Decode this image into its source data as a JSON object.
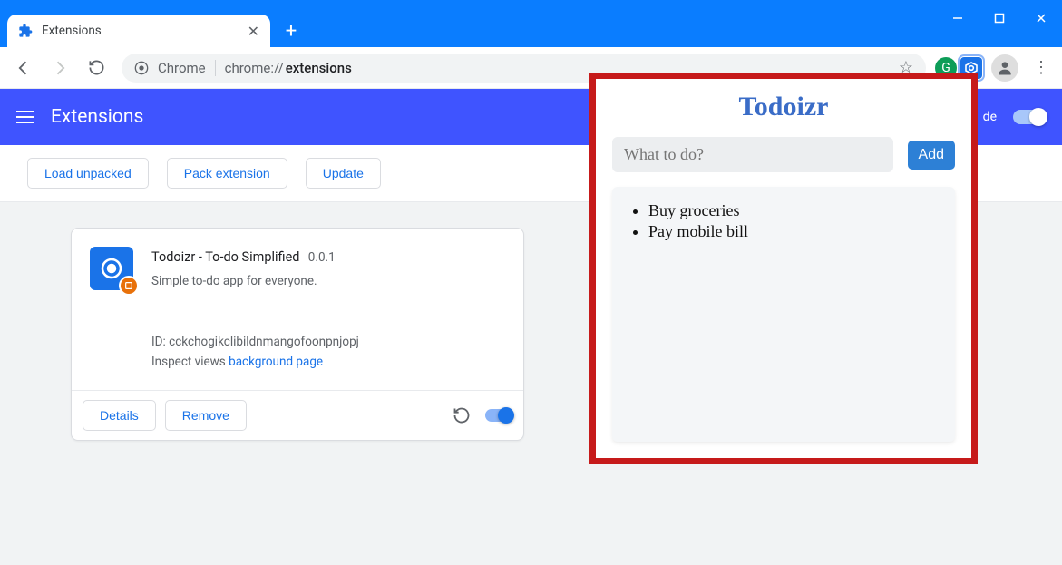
{
  "window": {
    "tab_title": "Extensions",
    "minimize": "—",
    "maximize": "◻",
    "close": "✕"
  },
  "omnibox": {
    "scheme_label": "Chrome",
    "scheme_prefix": "chrome://",
    "path_bold": "extensions",
    "star": "☆"
  },
  "page_header": {
    "title": "Extensions",
    "dev_mode_label": "de"
  },
  "actions": {
    "load_unpacked": "Load unpacked",
    "pack_extension": "Pack extension",
    "update": "Update"
  },
  "card": {
    "name": "Todoizr - To-do Simplified",
    "version": "0.0.1",
    "desc": "Simple to-do app for everyone.",
    "id_label": "ID:",
    "id_value": "cckchogikclibildnmangofoonpnjopj",
    "inspect_label": "Inspect views",
    "inspect_link": "background page",
    "details": "Details",
    "remove": "Remove"
  },
  "popup": {
    "title": "Todoizr",
    "placeholder": "What to do?",
    "add_label": "Add",
    "items": [
      "Buy groceries",
      "Pay mobile bill"
    ]
  }
}
